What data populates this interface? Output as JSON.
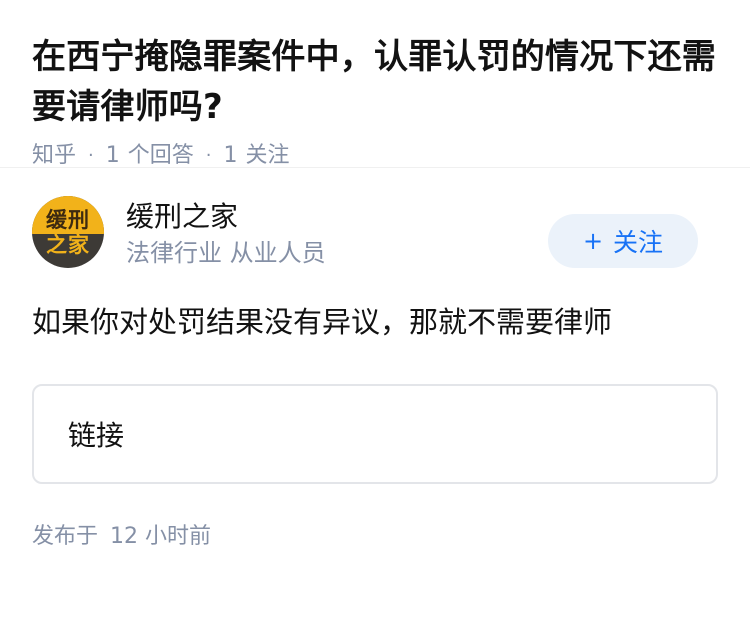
{
  "question": {
    "title": "在西宁掩隐罪案件中，认罪认罚的情况下还需要请律师吗?",
    "meta": {
      "site": "知乎",
      "answer_count": "1",
      "answer_label": "个回答",
      "follow_count": "1",
      "follow_label": "关注"
    }
  },
  "author": {
    "avatar_text_line1": "缓刑",
    "avatar_text_line2": "之家",
    "name": "缓刑之家",
    "headline": "法律行业 从业人员",
    "follow_button": {
      "icon": "+",
      "label": "关注"
    }
  },
  "answer": {
    "content": "如果你对处罚结果没有异议，那就不需要律师",
    "link_card_label": "链接",
    "publish_prefix": "发布于",
    "publish_time": "12 小时前"
  },
  "colors": {
    "accent": "#1772f6",
    "follow_bg": "#ebf2fa",
    "meta_gray": "#8590a6",
    "avatar_yellow": "#f2b21a",
    "avatar_dark": "#3d3a36"
  }
}
